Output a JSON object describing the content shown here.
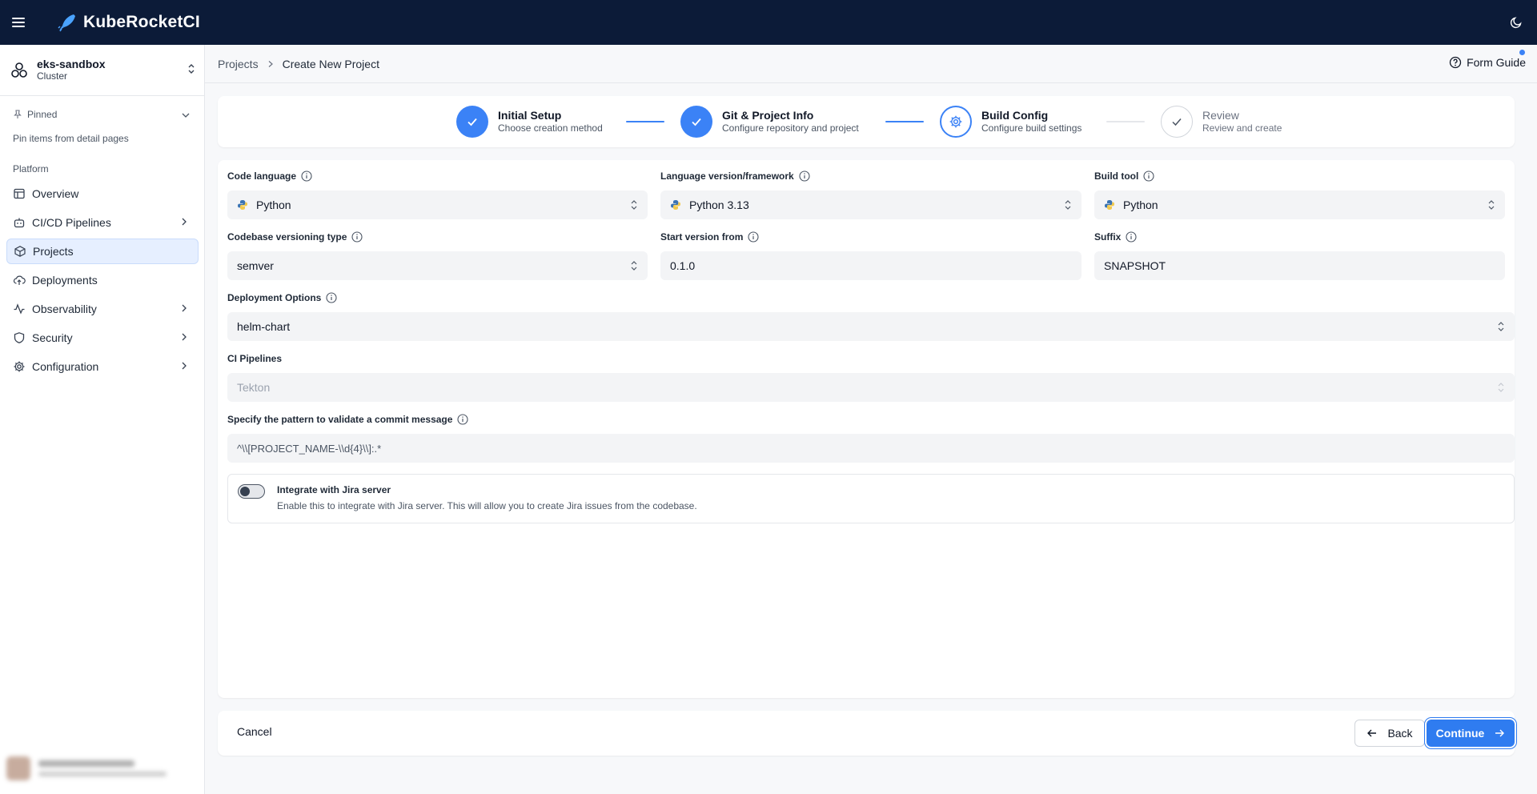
{
  "app": {
    "name": "KubeRocketCI"
  },
  "cluster": {
    "name": "eks-sandbox",
    "type": "Cluster"
  },
  "sidebar": {
    "pinned_label": "Pinned",
    "pin_hint": "Pin items from detail pages",
    "section_label": "Platform",
    "items": [
      {
        "label": "Overview",
        "icon": "table-icon",
        "has_children": false,
        "active": false
      },
      {
        "label": "CI/CD Pipelines",
        "icon": "bot-icon",
        "has_children": true,
        "active": false
      },
      {
        "label": "Projects",
        "icon": "box-icon",
        "has_children": false,
        "active": true
      },
      {
        "label": "Deployments",
        "icon": "cloud-upload-icon",
        "has_children": false,
        "active": false
      },
      {
        "label": "Observability",
        "icon": "activity-icon",
        "has_children": true,
        "active": false
      },
      {
        "label": "Security",
        "icon": "shield-icon",
        "has_children": true,
        "active": false
      },
      {
        "label": "Configuration",
        "icon": "gear-icon",
        "has_children": true,
        "active": false
      }
    ]
  },
  "breadcrumb": {
    "parent": "Projects",
    "current": "Create New Project"
  },
  "form_guide": {
    "label": "Form Guide"
  },
  "stepper": {
    "steps": [
      {
        "title": "Initial Setup",
        "desc": "Choose creation method",
        "state": "done"
      },
      {
        "title": "Git & Project Info",
        "desc": "Configure repository and project",
        "state": "done"
      },
      {
        "title": "Build Config",
        "desc": "Configure build settings",
        "state": "current"
      },
      {
        "title": "Review",
        "desc": "Review and create",
        "state": "todo"
      }
    ]
  },
  "form": {
    "code_language": {
      "label": "Code language",
      "value": "Python"
    },
    "language_version": {
      "label": "Language version/framework",
      "value": "Python 3.13"
    },
    "build_tool": {
      "label": "Build tool",
      "value": "Python"
    },
    "versioning_type": {
      "label": "Codebase versioning type",
      "value": "semver"
    },
    "start_version": {
      "label": "Start version from",
      "value": "0.1.0"
    },
    "suffix": {
      "label": "Suffix",
      "value": "SNAPSHOT"
    },
    "deployment_options": {
      "label": "Deployment Options",
      "value": "helm-chart"
    },
    "ci_pipelines": {
      "label": "CI Pipelines",
      "value": "Tekton"
    },
    "commit_pattern": {
      "label": "Specify the pattern to validate a commit message",
      "value": "^\\\\[PROJECT_NAME-\\\\d{4}\\\\]:.*"
    },
    "jira": {
      "title": "Integrate with Jira server",
      "description": "Enable this to integrate with Jira server. This will allow you to create Jira issues from the codebase.",
      "enabled": false
    }
  },
  "footer": {
    "cancel": "Cancel",
    "back": "Back",
    "continue": "Continue"
  },
  "colors": {
    "topbar": "#0c1b38",
    "accent": "#3b82f6",
    "active_nav": "#e6efff"
  }
}
